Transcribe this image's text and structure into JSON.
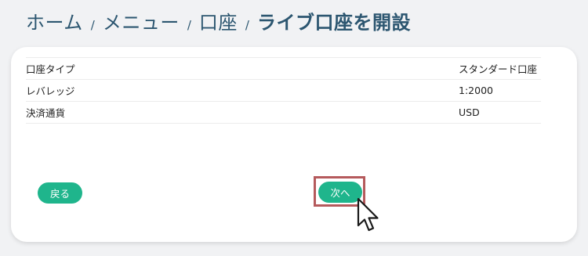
{
  "breadcrumb": {
    "items": [
      "ホーム",
      "メニュー",
      "口座"
    ],
    "current": "ライブ口座を開設",
    "separator": "/"
  },
  "details": {
    "rows": [
      {
        "label": "口座タイプ",
        "value": "スタンダード口座"
      },
      {
        "label": "レバレッジ",
        "value": "1:2000"
      },
      {
        "label": "決済通貨",
        "value": "USD"
      }
    ]
  },
  "actions": {
    "back_label": "戻る",
    "next_label": "次へ"
  },
  "colors": {
    "accent": "#1fb58c",
    "breadcrumb": "#2c5670",
    "highlight": "#b55a5c"
  }
}
